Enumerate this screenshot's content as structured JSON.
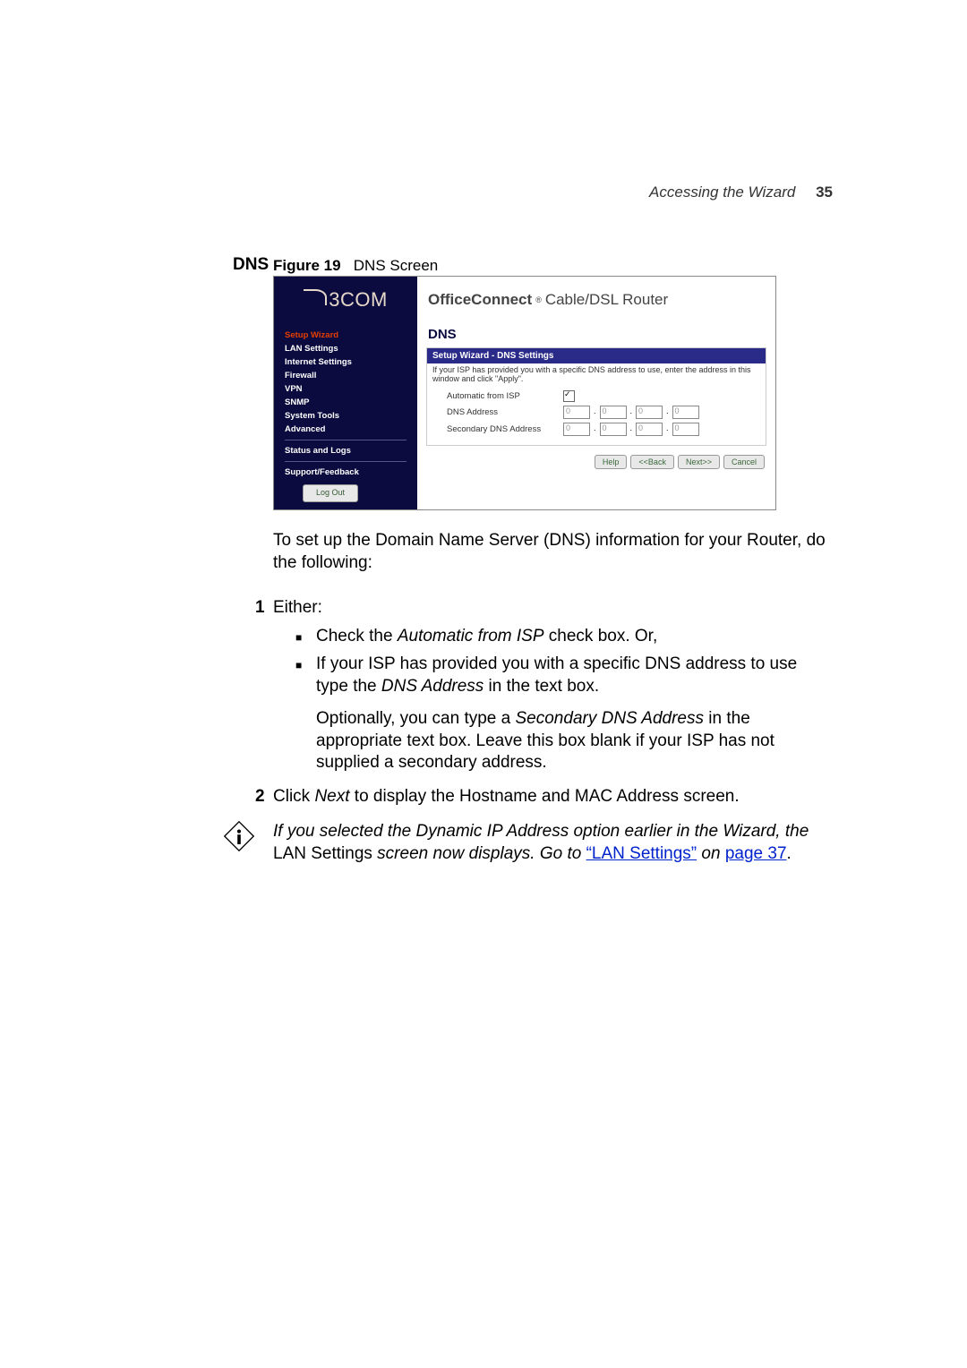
{
  "header": {
    "breadcrumb": "Accessing the Wizard",
    "page_number": "35"
  },
  "section_label": "DNS",
  "figure": {
    "label": "Figure 19",
    "caption": "DNS Screen"
  },
  "screenshot": {
    "logo": "3COM",
    "product_title_bold": "OfficeConnect",
    "product_title_rest": "Cable/DSL Router",
    "nav": {
      "setup_wizard": "Setup Wizard",
      "lan_settings": "LAN Settings",
      "internet_settings": "Internet Settings",
      "firewall": "Firewall",
      "vpn": "VPN",
      "snmp": "SNMP",
      "system_tools": "System Tools",
      "advanced": "Advanced",
      "status_logs": "Status and Logs",
      "support": "Support/Feedback",
      "logout": "Log Out"
    },
    "panel": {
      "heading": "DNS",
      "title": "Setup Wizard - DNS Settings",
      "desc": "If your ISP has provided you with a specific DNS address to use, enter the address in this window and click \"Apply\".",
      "row_auto": "Automatic from ISP",
      "row_dns": "DNS Address",
      "row_sec": "Secondary DNS Address",
      "ip_placeholder": "0"
    },
    "buttons": {
      "help": "Help",
      "back": "<<Back",
      "next": "Next>>",
      "cancel": "Cancel"
    }
  },
  "body": {
    "intro": "To set up the Domain Name Server (DNS) information for your Router, do the following:",
    "num1": "1",
    "either": "Either:",
    "bullet1_pre": "Check the ",
    "bullet1_italic": "Automatic from ISP",
    "bullet1_post": " check box. Or,",
    "bullet2_pre": "If your ISP has provided you with a specific DNS address to use type the ",
    "bullet2_italic": "DNS Address",
    "bullet2_post": " in the text box.",
    "bullet2_opt_pre": "Optionally, you can type a ",
    "bullet2_opt_italic": "Secondary DNS Address",
    "bullet2_opt_post": " in the appropriate text box. Leave this box blank if your ISP has not supplied a secondary address.",
    "num2": "2",
    "step2_pre": "Click ",
    "step2_italic": "Next",
    "step2_post": " to display the Hostname and MAC Address screen.",
    "note_line1": "If you selected the Dynamic IP Address option earlier in the Wizard, the ",
    "note_lan": "LAN Settings",
    "note_mid": " screen now displays. Go to ",
    "note_link": "“LAN Settings”",
    "note_on": " on ",
    "note_page": "page 37",
    "note_end": "."
  }
}
